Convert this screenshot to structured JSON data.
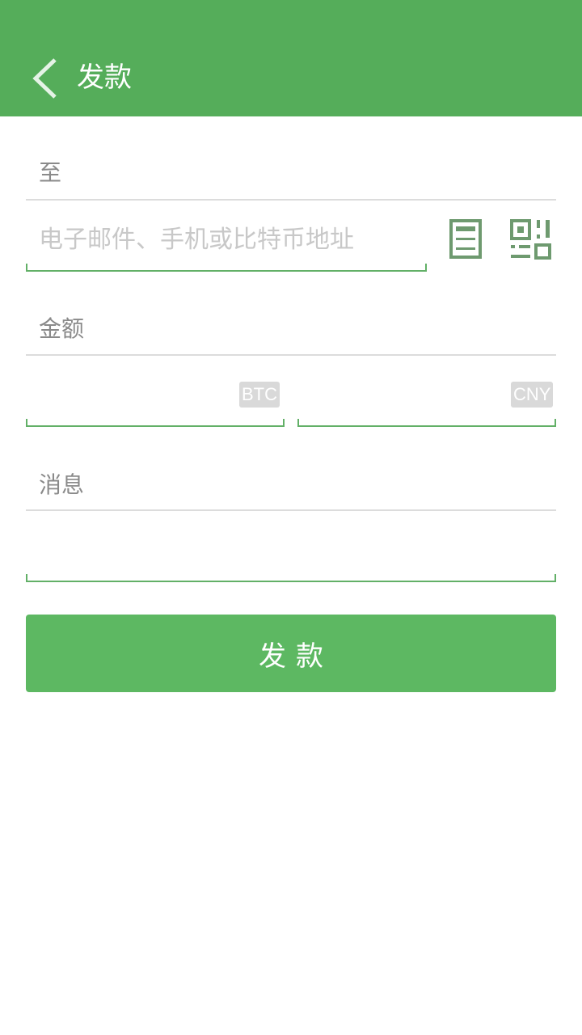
{
  "appbar": {
    "title": "发款",
    "back_icon": "chevron-left-icon"
  },
  "to_section": {
    "label": "至",
    "recipient_input": {
      "value": "",
      "placeholder": "电子邮件、手机或比特币地址"
    },
    "contacts_icon": "contact-book-icon",
    "scan_icon": "qr-code-icon"
  },
  "amount_section": {
    "label": "金额",
    "btc_input": {
      "value": "",
      "unit": "BTC"
    },
    "cny_input": {
      "value": "",
      "unit": "CNY"
    }
  },
  "message_section": {
    "label": "消息",
    "message_input": {
      "value": ""
    }
  },
  "submit": {
    "label": "发款"
  },
  "colors": {
    "primary": "#55ad5a",
    "button": "#5db862",
    "icon": "#6e9a6f",
    "divider": "#dcdcdc",
    "badge": "#d9d9d9"
  }
}
